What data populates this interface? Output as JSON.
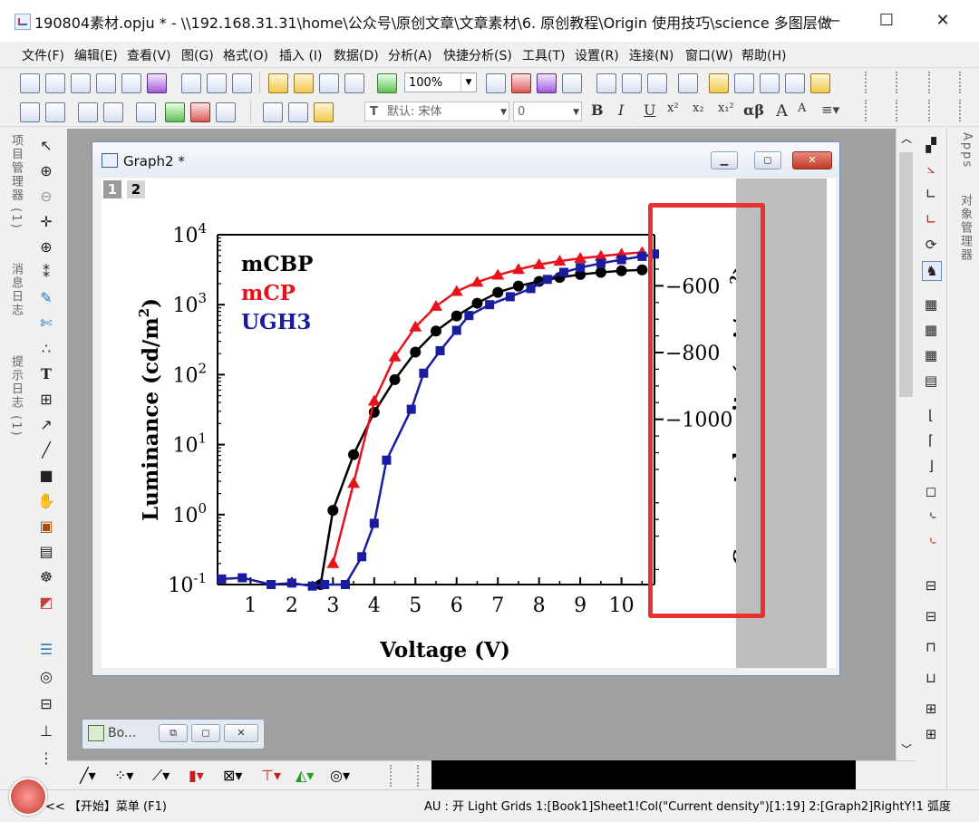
{
  "window": {
    "title": "190804素材.opju * - \\\\192.168.31.31\\home\\公众号\\原创文章\\文章素材\\6. 原创教程\\Origin 使用技巧\\science 多图层做...",
    "minimize": "—",
    "maximize": "☐",
    "close": "✕"
  },
  "menu": [
    "文件(F)",
    "编辑(E)",
    "查看(V)",
    "图(G)",
    "格式(O)",
    "插入 (I)",
    "数据(D)",
    "分析(A)",
    "快捷分析(S)",
    "工具(T)",
    "设置(R)",
    "连接(N)",
    "窗口(W)",
    "帮助(H)"
  ],
  "toolbar": {
    "zoom": "100%",
    "font_name": "默认: 宋体",
    "font_size": "0",
    "format_buttons": [
      "B",
      "I",
      "U",
      "x²",
      "x₂",
      "x₁²",
      "αβ",
      "A",
      "A"
    ]
  },
  "left_tabs": [
    "项目管理器 (1)",
    "消息日志",
    "提示日志 (1)"
  ],
  "right_tabs": [
    "Apps",
    "对象管理器"
  ],
  "graph_window": {
    "title": "Graph2 *",
    "layers": [
      "1",
      "2"
    ]
  },
  "chart_data": {
    "type": "line",
    "xlabel": "Voltage (V)",
    "ylabel_text": "Luminance (cd/m",
    "ylabel_sup": "2",
    "ylabel_close": ")",
    "y2label_text": "Current density (mA/cm",
    "y2label_sup": "2",
    "y2label_close": ")",
    "x_ticks": [
      "1",
      "2",
      "3",
      "4",
      "5",
      "6",
      "7",
      "8",
      "9",
      "10"
    ],
    "y_tick_exponents": [
      "4",
      "3",
      "2",
      "1",
      "0",
      "-1"
    ],
    "y_log_range": [
      -1,
      4
    ],
    "xlim": [
      0.2,
      10.8
    ],
    "y2_ticks": [
      "−600",
      "−800",
      "−1000"
    ],
    "y2_tick_values": [
      -600,
      -800,
      -1000
    ],
    "y2lim": [
      -1495,
      -447
    ],
    "legend_position": "top-left",
    "series": [
      {
        "name": "mCBP",
        "color": "#000000",
        "marker": "circle",
        "points": [
          [
            2.7,
            0.1
          ],
          [
            3.0,
            1.15
          ],
          [
            3.5,
            7.2
          ],
          [
            4.0,
            29
          ],
          [
            4.5,
            85
          ],
          [
            5.0,
            210
          ],
          [
            5.5,
            420
          ],
          [
            6.0,
            690
          ],
          [
            6.5,
            1050
          ],
          [
            7.0,
            1500
          ],
          [
            7.5,
            1850
          ],
          [
            8.0,
            2150
          ],
          [
            8.5,
            2450
          ],
          [
            9.0,
            2700
          ],
          [
            9.5,
            2900
          ],
          [
            10.0,
            3050
          ],
          [
            10.5,
            3150
          ]
        ]
      },
      {
        "name": "mCP",
        "color": "#e8121b",
        "marker": "triangle",
        "points": [
          [
            3.0,
            0.2
          ],
          [
            3.5,
            2.8
          ],
          [
            4.0,
            42
          ],
          [
            4.5,
            180
          ],
          [
            5.0,
            480
          ],
          [
            5.5,
            950
          ],
          [
            6.0,
            1550
          ],
          [
            6.5,
            2100
          ],
          [
            7.0,
            2650
          ],
          [
            7.5,
            3200
          ],
          [
            8.0,
            3750
          ],
          [
            8.5,
            4200
          ],
          [
            9.0,
            4600
          ],
          [
            9.5,
            4950
          ],
          [
            10.0,
            5300
          ],
          [
            10.5,
            5600
          ]
        ]
      },
      {
        "name": "UGH3",
        "color": "#1a1ca0",
        "marker": "square",
        "points": [
          [
            0.3,
            0.12
          ],
          [
            0.8,
            0.125
          ],
          [
            1.5,
            0.1
          ],
          [
            2.0,
            0.105
          ],
          [
            2.5,
            0.095
          ],
          [
            2.8,
            0.1
          ],
          [
            3.3,
            0.1
          ],
          [
            3.7,
            0.25
          ],
          [
            4.0,
            0.75
          ],
          [
            4.3,
            6
          ],
          [
            4.9,
            32
          ],
          [
            5.2,
            105
          ],
          [
            5.6,
            220
          ],
          [
            6.0,
            430
          ],
          [
            6.3,
            700
          ],
          [
            6.8,
            1000
          ],
          [
            7.3,
            1300
          ],
          [
            7.8,
            1700
          ],
          [
            8.2,
            2300
          ],
          [
            8.6,
            2900
          ],
          [
            9.0,
            3400
          ],
          [
            9.5,
            3900
          ],
          [
            10.0,
            4400
          ],
          [
            10.5,
            4900
          ],
          [
            10.8,
            5300
          ]
        ]
      }
    ]
  },
  "minimized_window": {
    "title": "Bo..."
  },
  "statusbar": {
    "start": "<< 【开始】菜单 (F1)",
    "au": "AU : 开  Light Grids  1:[Book1]Sheet1!Col(\"Current density\")[1:19]  2:[Graph2]RightY!1  弧度"
  },
  "colors": {
    "highlight": "#e8322e",
    "workspace": "#a0a0a0"
  }
}
